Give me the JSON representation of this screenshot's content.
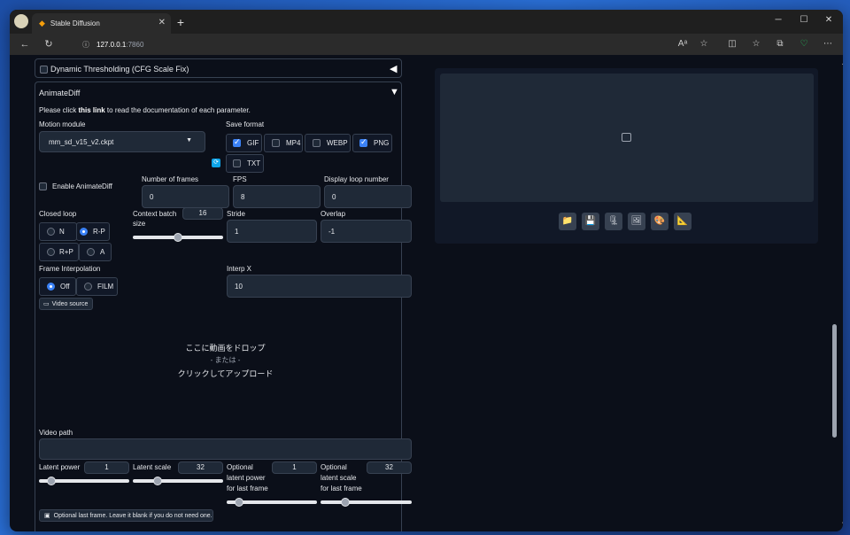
{
  "browser": {
    "tab_title": "Stable Diffusion",
    "new_tab": "+",
    "close": "✕",
    "url_host": "127.0.0.1",
    "url_port": ":7860",
    "win_min": "─",
    "win_max": "☐",
    "win_close": "✕"
  },
  "dynamic_thresholding": {
    "label": "Dynamic Thresholding (CFG Scale Fix)",
    "arrow": "◀"
  },
  "animatediff": {
    "title": "AnimateDiff",
    "arrow": "▼",
    "intro_before": "Please click ",
    "intro_link": "this link",
    "intro_after": " to read the documentation of each parameter.",
    "motion_module_label": "Motion module",
    "motion_module_value": "mm_sd_v15_v2.ckpt",
    "save_format_label": "Save format",
    "save_formats": [
      {
        "label": "GIF",
        "checked": true
      },
      {
        "label": "MP4",
        "checked": false
      },
      {
        "label": "WEBP",
        "checked": false
      },
      {
        "label": "PNG",
        "checked": true
      },
      {
        "label": "TXT",
        "checked": false
      }
    ],
    "enable_label": "Enable AnimateDiff",
    "frames_label": "Number of frames",
    "frames_value": "0",
    "fps_label": "FPS",
    "fps_value": "8",
    "loop_label": "Display loop number",
    "loop_value": "0",
    "closed_loop_label": "Closed loop",
    "closed_loop_options": [
      {
        "label": "N",
        "selected": false
      },
      {
        "label": "R-P",
        "selected": true
      },
      {
        "label": "R+P",
        "selected": false
      },
      {
        "label": "A",
        "selected": false
      }
    ],
    "context_batch_label_1": "Context batch",
    "context_batch_label_2": "size",
    "context_batch_value": "16",
    "context_batch_fraction": 0.5,
    "stride_label": "Stride",
    "stride_value": "1",
    "overlap_label": "Overlap",
    "overlap_value": "-1",
    "frame_interp_label": "Frame Interpolation",
    "frame_interp_options": [
      {
        "label": "Off",
        "selected": true
      },
      {
        "label": "FILM",
        "selected": false
      }
    ],
    "interp_x_label": "Interp X",
    "interp_x_value": "10",
    "video_source_label": "Video source",
    "drop_line1": "ここに動画をドロップ",
    "drop_line2": "- または -",
    "drop_line3": "クリックしてアップロード",
    "video_path_label": "Video path",
    "video_path_value": "",
    "latent_power_label": "Latent power",
    "latent_power_value": "1",
    "latent_scale_label": "Latent scale",
    "latent_scale_value": "32",
    "opt_latent_power_l1": "Optional",
    "opt_latent_power_l2": "latent power",
    "opt_latent_power_l3": "for last frame",
    "opt_latent_power_value": "1",
    "opt_latent_scale_l1": "Optional",
    "opt_latent_scale_l2": "latent scale",
    "opt_latent_scale_l3": "for last frame",
    "opt_latent_scale_value": "32",
    "last_frame_hint": "Optional last frame. Leave it blank if you do not need one."
  },
  "output_toolbar": [
    {
      "icon": "folder-icon",
      "glyph": "📁"
    },
    {
      "icon": "save-icon",
      "glyph": "💾"
    },
    {
      "icon": "zip-icon",
      "glyph": "🗜"
    },
    {
      "icon": "send-to-img2img-icon",
      "glyph": "🖼"
    },
    {
      "icon": "send-to-inpaint-icon",
      "glyph": "🎨"
    },
    {
      "icon": "send-to-extras-icon",
      "glyph": "📐"
    }
  ]
}
